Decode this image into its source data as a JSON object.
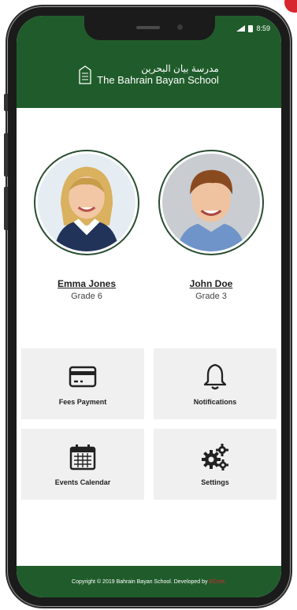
{
  "status_bar": {
    "time": "8:59"
  },
  "school": {
    "arabic_name": "مدرسة بيان البحرين",
    "english_name": "The Bahrain Bayan School"
  },
  "students": [
    {
      "name": "Emma Jones",
      "grade": "Grade 6"
    },
    {
      "name": "John Doe",
      "grade": "Grade 3"
    }
  ],
  "tiles": [
    {
      "label": "Fees Payment",
      "icon": "credit-card-icon"
    },
    {
      "label": "Notifications",
      "icon": "bell-icon"
    },
    {
      "label": "Events Calendar",
      "icon": "calendar-icon"
    },
    {
      "label": "Settings",
      "icon": "gears-icon"
    }
  ],
  "footer": {
    "text": "Copyright © 2019 Bahrain Bayan School. Developed by",
    "developer": "ECnet."
  },
  "colors": {
    "header_green": "#205c2b",
    "accent_red": "#d7262e",
    "tile_bg": "#f0f0f0"
  }
}
